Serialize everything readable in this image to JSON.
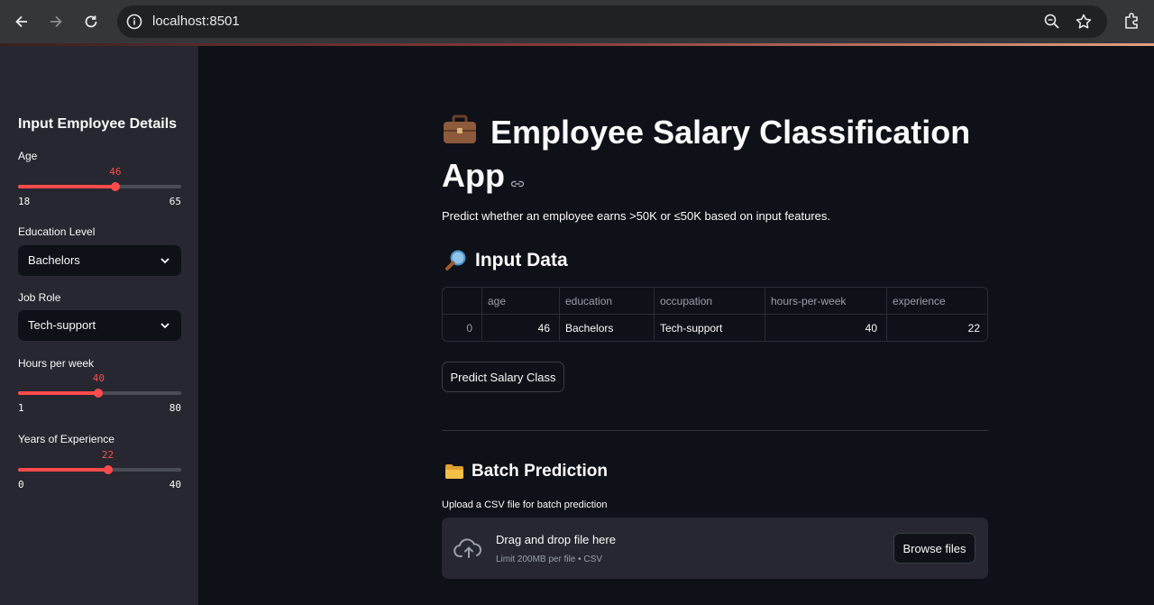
{
  "browser": {
    "url": "localhost:8501"
  },
  "sidebar": {
    "title": "Input Employee Details",
    "age": {
      "label": "Age",
      "value": "46",
      "min": "18",
      "max": "65",
      "fraction": 0.596
    },
    "education": {
      "label": "Education Level",
      "value": "Bachelors"
    },
    "job_role": {
      "label": "Job Role",
      "value": "Tech-support"
    },
    "hours": {
      "label": "Hours per week",
      "value": "40",
      "min": "1",
      "max": "80",
      "fraction": 0.494
    },
    "experience": {
      "label": "Years of Experience",
      "value": "22",
      "min": "0",
      "max": "40",
      "fraction": 0.55
    }
  },
  "main": {
    "title": "Employee Salary Classification App",
    "subtitle": "Predict whether an employee earns >50K or ≤50K based on input features.",
    "input_heading": "Input Data",
    "table": {
      "columns": [
        "",
        "age",
        "education",
        "occupation",
        "hours-per-week",
        "experience"
      ],
      "rows": [
        [
          "0",
          "46",
          "Bachelors",
          "Tech-support",
          "40",
          "22"
        ]
      ]
    },
    "predict_button": "Predict Salary Class",
    "batch_heading": "Batch Prediction",
    "upload_label": "Upload a CSV file for batch prediction",
    "dropzone_main": "Drag and drop file here",
    "dropzone_sub": "Limit 200MB per file • CSV",
    "browse_button": "Browse files"
  },
  "colors": {
    "accent": "#ff4b4b",
    "background": "#0e1117",
    "sidebar": "#262730"
  }
}
